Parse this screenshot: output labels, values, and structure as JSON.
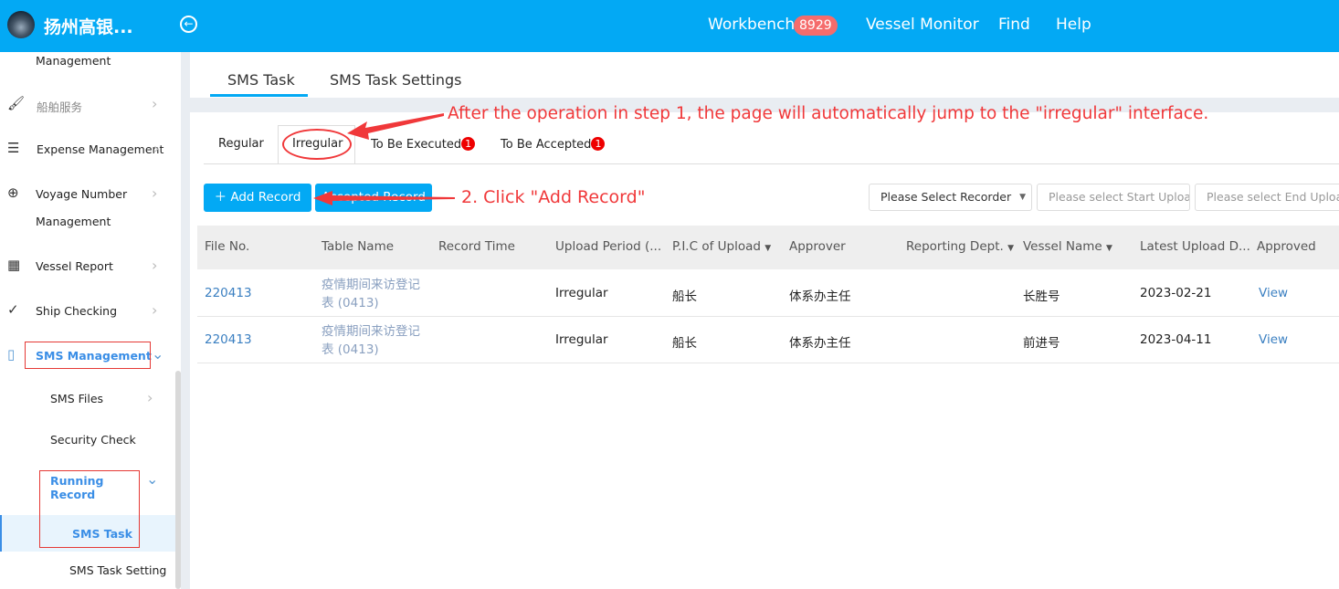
{
  "header": {
    "brand": "扬州高银...",
    "nav": [
      {
        "label": "Workbench",
        "badge": "8929"
      },
      {
        "label": "Vessel Monitor"
      },
      {
        "label": "Find"
      },
      {
        "label": "Help"
      }
    ]
  },
  "sidebar": {
    "items": [
      {
        "label": "Management",
        "icon": "none"
      },
      {
        "label": "船舶服务",
        "icon": "paint-roller-icon"
      },
      {
        "label": "Expense Management",
        "icon": "database-icon"
      },
      {
        "label": "Voyage Number",
        "label2": "Management",
        "icon": "globe-icon"
      },
      {
        "label": "Vessel Report",
        "icon": "calendar-icon"
      },
      {
        "label": "Ship Checking",
        "icon": "check-circle-icon"
      },
      {
        "label": "SMS Management",
        "icon": "files-icon"
      }
    ],
    "sub": [
      {
        "label": "SMS Files"
      },
      {
        "label": "Security Check"
      },
      {
        "label": "Running",
        "label2": "Record"
      },
      {
        "label": "SMS Task"
      },
      {
        "label": "SMS Task Setting"
      }
    ]
  },
  "tabs": [
    "SMS Task",
    "SMS Task Settings"
  ],
  "subtabs": [
    {
      "label": "Regular"
    },
    {
      "label": "Irregular"
    },
    {
      "label": "To Be Executed",
      "count": "1"
    },
    {
      "label": "To Be Accepted",
      "count": "1"
    }
  ],
  "toolbar": {
    "add": "Add Record",
    "accepted": "Accepted Record",
    "recorder": "Please Select Recorder",
    "start": "Please select Start Upload",
    "end": "Please select End Upload"
  },
  "table": {
    "headers": [
      "File No.",
      "Table Name",
      "Record Time",
      "Upload Period (...",
      "P.I.C of Upload",
      "Approver",
      "Reporting Dept.",
      "Vessel Name",
      "Latest Upload D...",
      "Approved"
    ],
    "rows": [
      {
        "file": "220413",
        "name1": "疫情期间来访登记",
        "name2": "表 (0413)",
        "time": "",
        "period": "Irregular",
        "pic": "船长",
        "approver": "体系办主任",
        "dept": "",
        "vessel": "长胜号",
        "latest": "2023-02-21",
        "approved": "View"
      },
      {
        "file": "220413",
        "name1": "疫情期间来访登记",
        "name2": "表 (0413)",
        "time": "",
        "period": "Irregular",
        "pic": "船长",
        "approver": "体系办主任",
        "dept": "",
        "vessel": "前进号",
        "latest": "2023-04-11",
        "approved": "View"
      }
    ]
  },
  "annotations": {
    "a1": "After the operation in step 1, the page will automatically jump to the \"irregular\" interface.",
    "a2": "2. Click \"Add Record\""
  },
  "colors": {
    "primary": "#03a9f4",
    "annotation": "#f0383a"
  }
}
